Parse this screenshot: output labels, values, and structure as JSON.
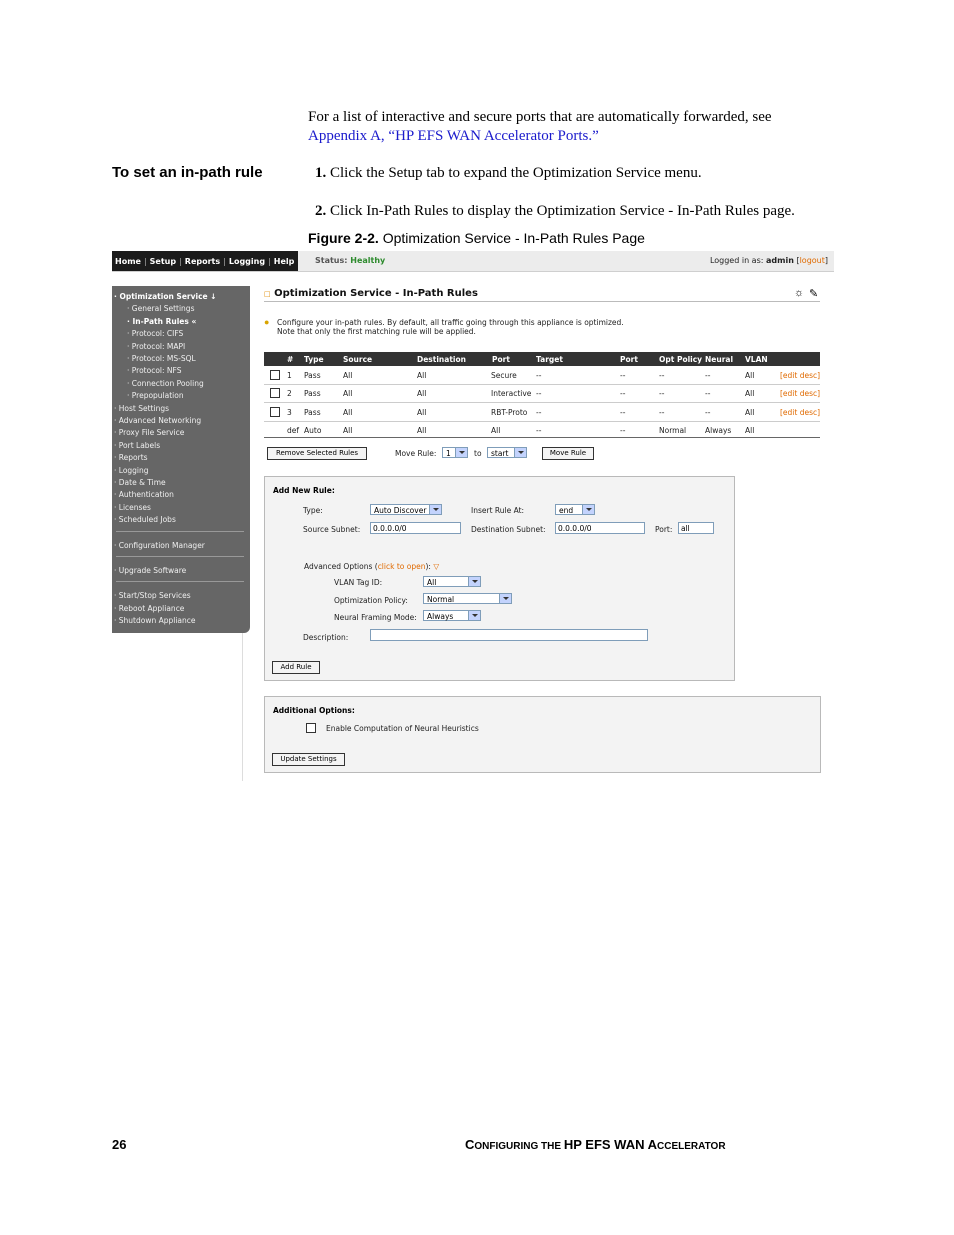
{
  "intro": {
    "line1": "For a list of interactive and secure ports that are automatically forwarded, see",
    "link": "Appendix A, “HP EFS WAN Accelerator Ports.”"
  },
  "side_heading": "To set an in-path rule",
  "steps": [
    {
      "num": "1.",
      "text": "Click the Setup tab to expand the Optimization Service menu."
    },
    {
      "num": "2.",
      "text": "Click In-Path Rules to display the Optimization Service - In-Path Rules page."
    }
  ],
  "figure": {
    "label": "Figure 2-2.",
    "caption": "Optimization Service - In-Path Rules Page"
  },
  "screenshot": {
    "nav": [
      "Home",
      "Setup",
      "Reports",
      "Logging",
      "Help"
    ],
    "status_label": "Status:",
    "status_value": "Healthy",
    "logged_in_prefix": "Logged in as:",
    "user": "admin",
    "logout": "logout",
    "sidebar": [
      {
        "label": "· Optimization Service ↓",
        "bold": true
      },
      {
        "label": "· General Settings"
      },
      {
        "label": "· In-Path Rules «",
        "bold": true
      },
      {
        "label": "· Protocol: CIFS"
      },
      {
        "label": "· Protocol: MAPI"
      },
      {
        "label": "· Protocol: MS-SQL"
      },
      {
        "label": "· Protocol: NFS"
      },
      {
        "label": "· Connection Pooling"
      },
      {
        "label": "· Prepopulation"
      },
      {
        "label": "· Host Settings"
      },
      {
        "label": "· Advanced Networking"
      },
      {
        "label": "· Proxy File Service"
      },
      {
        "label": "· Port Labels"
      },
      {
        "label": "· Reports"
      },
      {
        "label": "· Logging"
      },
      {
        "label": "· Date & Time"
      },
      {
        "label": "· Authentication"
      },
      {
        "label": "· Licenses"
      },
      {
        "label": "· Scheduled Jobs"
      },
      {
        "label": "· Configuration Manager"
      },
      {
        "label": "· Upgrade Software"
      },
      {
        "label": "· Start/Stop Services"
      },
      {
        "label": "· Reboot Appliance"
      },
      {
        "label": "· Shutdown Appliance"
      }
    ],
    "page_title": "Optimization Service - In-Path Rules",
    "hint1": "Configure your in-path rules. By default, all traffic going through this appliance is optimized.",
    "hint2": "Note that only the first matching rule will be applied.",
    "table_headers": [
      "#",
      "Type",
      "Source",
      "Destination",
      "Port",
      "Target",
      "Port",
      "Opt Policy",
      "Neural",
      "VLAN"
    ],
    "rows": [
      {
        "num": "1",
        "type": "Pass",
        "source": "All",
        "dest": "All",
        "port": "Secure",
        "target": "--",
        "tport": "--",
        "opt": "--",
        "neural": "--",
        "vlan": "All",
        "edit": "[edit desc]"
      },
      {
        "num": "2",
        "type": "Pass",
        "source": "All",
        "dest": "All",
        "port": "Interactive",
        "target": "--",
        "tport": "--",
        "opt": "--",
        "neural": "--",
        "vlan": "All",
        "edit": "[edit desc]"
      },
      {
        "num": "3",
        "type": "Pass",
        "source": "All",
        "dest": "All",
        "port": "RBT-Proto",
        "target": "--",
        "tport": "--",
        "opt": "--",
        "neural": "--",
        "vlan": "All",
        "edit": "[edit desc]"
      },
      {
        "num": "def",
        "type": "Auto",
        "source": "All",
        "dest": "All",
        "port": "All",
        "target": "--",
        "tport": "--",
        "opt": "Normal",
        "neural": "Always",
        "vlan": "All",
        "edit": ""
      }
    ],
    "remove_btn": "Remove Selected Rules",
    "move_rule_label": "Move Rule:",
    "move_from": "1",
    "to_label": "to",
    "move_to": "start",
    "move_btn": "Move Rule",
    "add_new_rule": "Add New Rule:",
    "type_label": "Type:",
    "type_value": "Auto Discover",
    "insert_label": "Insert Rule At:",
    "insert_value": "end",
    "src_label": "Source Subnet:",
    "src_value": "0.0.0.0/0",
    "dst_label": "Destination Subnet:",
    "dst_value": "0.0.0.0/0",
    "port_label": "Port:",
    "port_value": "all",
    "adv_label": "Advanced Options (",
    "adv_link": "click to open",
    "adv_end": "):",
    "vlan_label": "VLAN Tag ID:",
    "vlan_value": "All",
    "opt_label": "Optimization Policy:",
    "opt_value": "Normal",
    "nfm_label": "Neural Framing Mode:",
    "nfm_value": "Always",
    "desc_label": "Description:",
    "add_btn": "Add Rule",
    "additional": "Additional Options:",
    "neural_chk": "Enable Computation of Neural Heuristics",
    "update_btn": "Update Settings"
  },
  "footer": {
    "page": "26",
    "title_parts": [
      "C",
      "ONFIGURING THE ",
      "HP EFS WAN A",
      "CCELERATOR"
    ]
  }
}
